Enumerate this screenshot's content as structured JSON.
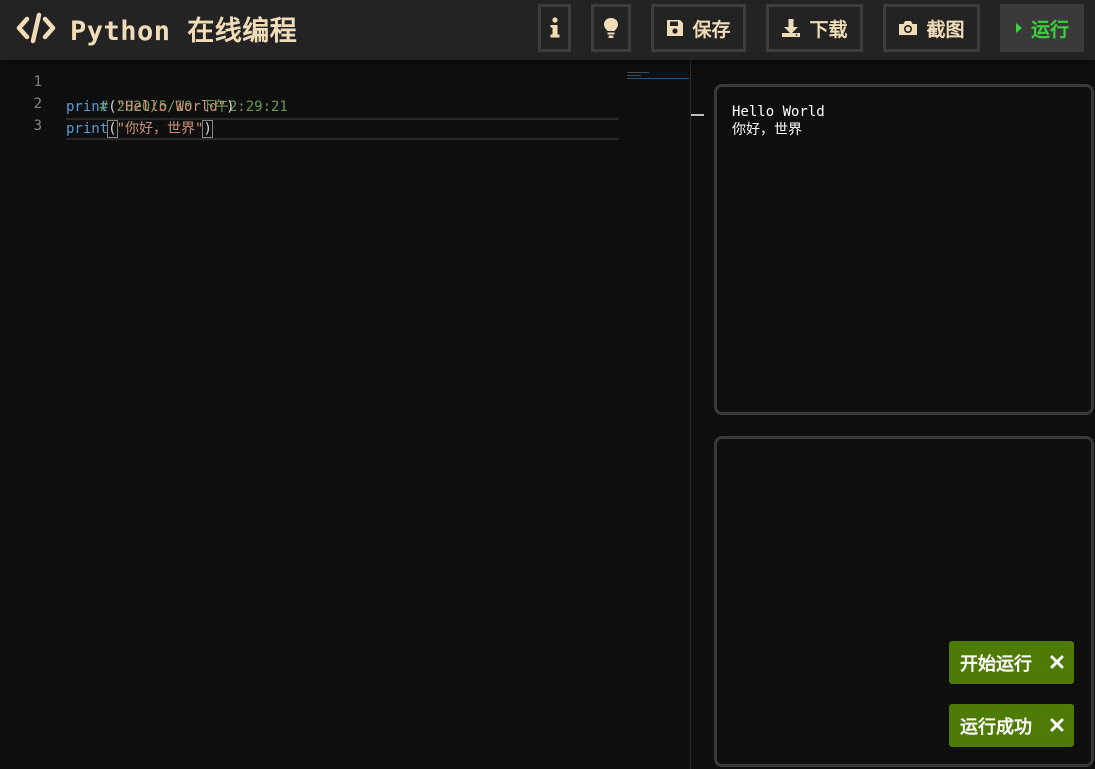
{
  "header": {
    "title": "Python 在线编程",
    "logo_icon": "code-icon",
    "buttons": {
      "info_icon": "info-icon",
      "tip_icon": "lightbulb-icon",
      "save_label": "保存",
      "download_label": "下载",
      "screenshot_label": "截图",
      "run_label": "运行"
    }
  },
  "editor": {
    "line_numbers": [
      "1",
      "2",
      "3"
    ],
    "lines": [
      {
        "comment": "# 2020/5/10 下午2:29:21"
      },
      {
        "fn": "print",
        "open": "(",
        "str": "\"Hello World\"",
        "close": ")"
      },
      {
        "fn": "print",
        "open": "(",
        "str": "\"你好，世界\"",
        "close": ")"
      }
    ]
  },
  "output": {
    "lines": [
      "Hello World",
      "你好，世界"
    ]
  },
  "toasts": [
    {
      "label": "开始运行"
    },
    {
      "label": "运行成功"
    }
  ],
  "colors": {
    "accent_text": "#f1dcb8",
    "run_green": "#3bd23b",
    "toast_green": "#4e7a06",
    "comment": "#6a9955",
    "keyword": "#569cd6",
    "string": "#ce9178"
  }
}
